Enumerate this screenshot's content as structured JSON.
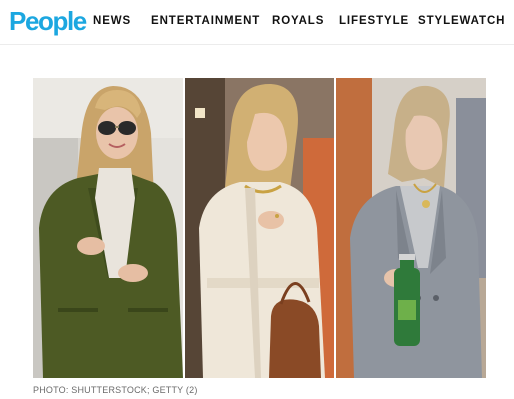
{
  "header": {
    "logo": "People",
    "nav": [
      "NEWS",
      "ENTERTAINMENT",
      "ROYALS",
      "LIFESTYLE",
      "STYLEWATCH"
    ]
  },
  "article": {
    "photo_credit": "PHOTO: SHUTTERSTOCK; GETTY (2)"
  },
  "colors": {
    "brand": "#1ca7e0",
    "nav_text": "#111111",
    "caption_text": "#6b6b6b"
  }
}
